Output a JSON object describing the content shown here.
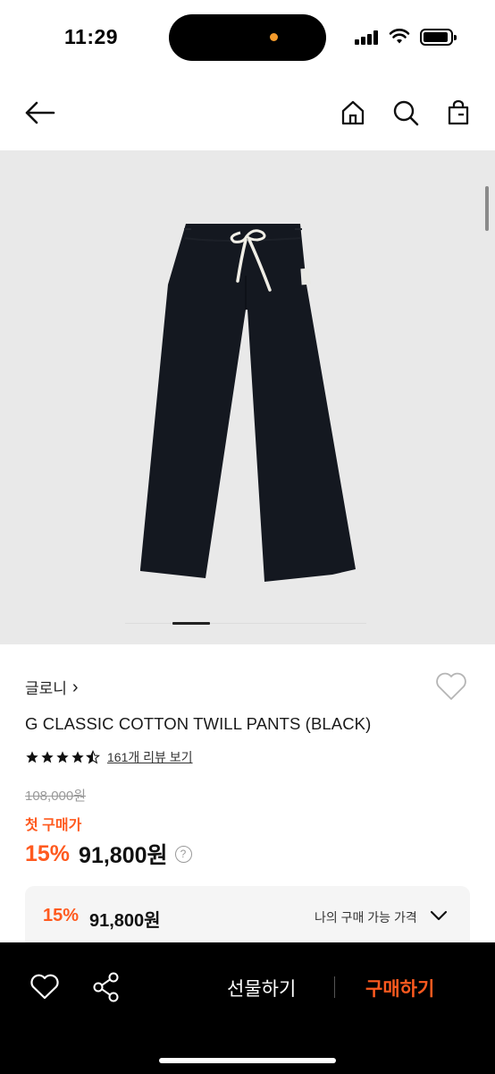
{
  "status_bar": {
    "time": "11:29"
  },
  "product": {
    "brand": "글로니",
    "brand_chevron": "›",
    "title": "G CLASSIC COTTON TWILL PANTS (BLACK)",
    "rating": 4.5,
    "review_link": "161개 리뷰 보기",
    "original_price": "108,000원",
    "first_purchase_label": "첫 구매가",
    "discount": "15%",
    "price": "91,800원",
    "help_icon": "?"
  },
  "price_box": {
    "discount": "15%",
    "price": "91,800원",
    "label": "나의 구매 가능 가격"
  },
  "bottom_bar": {
    "gift_label": "선물하기",
    "buy_label": "구매하기"
  },
  "icons": {
    "back": "back-arrow-icon",
    "home": "home-icon",
    "search": "search-icon",
    "bag": "shopping-bag-icon",
    "heart": "heart-icon",
    "share": "share-icon",
    "chevron": "chevron-down-icon"
  },
  "colors": {
    "accent": "#ff5a1f",
    "image_bg": "#e9e9e9",
    "bottom_bar": "#000000"
  }
}
